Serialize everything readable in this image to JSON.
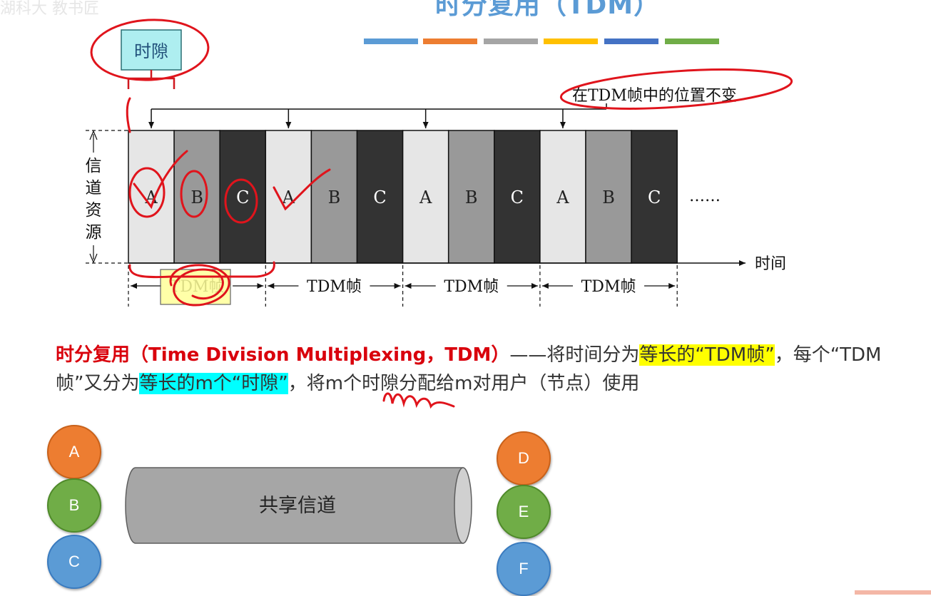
{
  "slide": {
    "title": "时分复用（TDM）",
    "watermark": "湖科大 教书匠"
  },
  "color_bar_colors": [
    "#5b9bd5",
    "#ed7d31",
    "#a5a5a5",
    "#ffc000",
    "#4472c4",
    "#70ad47"
  ],
  "diagram": {
    "time_slot_label": "时隙",
    "position_note": "在TDM帧中的位置不变",
    "channel_resource_chars": [
      "信",
      "道",
      "资",
      "源"
    ],
    "time_axis_label": "时间",
    "slot_labels": [
      "A",
      "B",
      "C",
      "A",
      "B",
      "C",
      "A",
      "B",
      "C",
      "A",
      "B",
      "C"
    ],
    "slot_shades": [
      "#e6e6e6",
      "#999999",
      "#333333"
    ],
    "ellipsis": "……",
    "frame_labels": [
      "TDM帧",
      "TDM帧",
      "TDM帧",
      "TDM帧"
    ]
  },
  "definition": {
    "term": "时分复用（Time Division Multiplexing，TDM）",
    "part1": "——将时间分为",
    "hl1": "等长的“TDM帧”",
    "part2": "，每个“TDM帧”又分为",
    "hl2": "等长的m个“时隙”",
    "part3": "，将m个时隙分配给m对用户（节点）使用"
  },
  "channel": {
    "label": "共享信道",
    "left_nodes": [
      "A",
      "B",
      "C"
    ],
    "right_nodes": [
      "D",
      "E",
      "F"
    ]
  }
}
